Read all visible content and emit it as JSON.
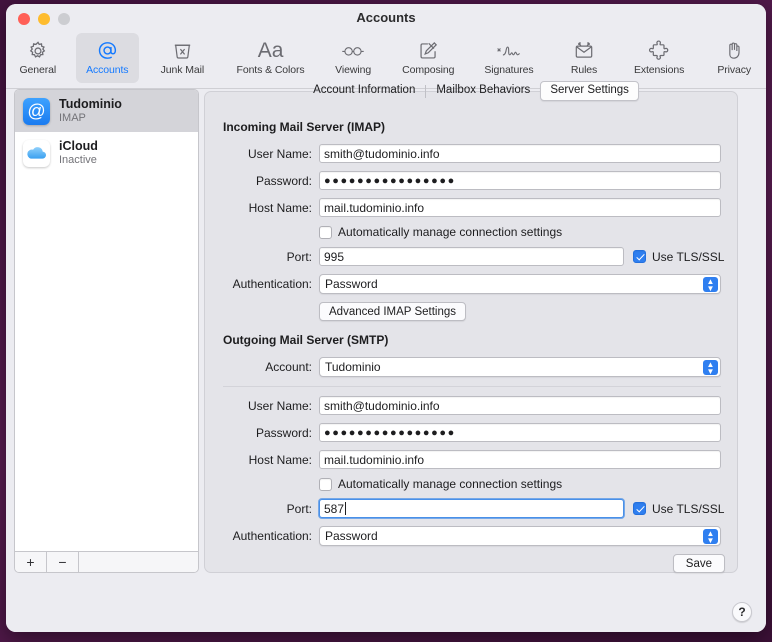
{
  "window": {
    "title": "Accounts",
    "traffic_lights": [
      "close-red",
      "minimize-yellow",
      "zoom-gray-disabled"
    ]
  },
  "toolbar": {
    "items": [
      {
        "label": "General",
        "icon": "gear-icon",
        "selected": false
      },
      {
        "label": "Accounts",
        "icon": "at-sign-icon",
        "selected": true
      },
      {
        "label": "Junk Mail",
        "icon": "trash-x-icon",
        "selected": false
      },
      {
        "label": "Fonts & Colors",
        "icon": "aa-text-icon",
        "selected": false
      },
      {
        "label": "Viewing",
        "icon": "glasses-icon",
        "selected": false
      },
      {
        "label": "Composing",
        "icon": "compose-pencil-icon",
        "selected": false
      },
      {
        "label": "Signatures",
        "icon": "signature-icon",
        "selected": false
      },
      {
        "label": "Rules",
        "icon": "envelope-arrows-icon",
        "selected": false
      },
      {
        "label": "Extensions",
        "icon": "puzzle-piece-icon",
        "selected": false
      },
      {
        "label": "Privacy",
        "icon": "hand-icon",
        "selected": false
      }
    ]
  },
  "sidebar": {
    "accounts": [
      {
        "name": "Tudominio",
        "status": "IMAP",
        "icon": "mail-at-icon",
        "selected": true
      },
      {
        "name": "iCloud",
        "status": "Inactive",
        "icon": "icloud-icon",
        "selected": false
      }
    ],
    "add_label": "+",
    "remove_label": "−"
  },
  "tabs": [
    {
      "label": "Account Information",
      "active": false
    },
    {
      "label": "Mailbox Behaviors",
      "active": false
    },
    {
      "label": "Server Settings",
      "active": true
    }
  ],
  "incoming": {
    "title": "Incoming Mail Server (IMAP)",
    "user_name_label": "User Name:",
    "user_name_value": "smith@tudominio.info",
    "password_label": "Password:",
    "password_value": "●●●●●●●●●●●●●●●●",
    "host_name_label": "Host Name:",
    "host_name_value": "mail.tudominio.info",
    "auto_manage_label": "Automatically manage connection settings",
    "auto_manage_checked": false,
    "port_label": "Port:",
    "port_value": "995",
    "tls_label": "Use TLS/SSL",
    "tls_checked": true,
    "auth_label": "Authentication:",
    "auth_value": "Password",
    "advanced_button": "Advanced IMAP Settings"
  },
  "outgoing": {
    "title": "Outgoing Mail Server (SMTP)",
    "account_label": "Account:",
    "account_value": "Tudominio",
    "user_name_label": "User Name:",
    "user_name_value": "smith@tudominio.info",
    "password_label": "Password:",
    "password_value": "●●●●●●●●●●●●●●●●",
    "host_name_label": "Host Name:",
    "host_name_value": "mail.tudominio.info",
    "auto_manage_label": "Automatically manage connection settings",
    "auto_manage_checked": false,
    "port_label": "Port:",
    "port_value": "587",
    "port_focused": true,
    "tls_label": "Use TLS/SSL",
    "tls_checked": true,
    "auth_label": "Authentication:",
    "auth_value": "Password"
  },
  "footer": {
    "save_label": "Save",
    "help_label": "?"
  },
  "colors": {
    "accent": "#157aff",
    "checkbox_on": "#2f7ff0",
    "window_bg": "#ececf1",
    "panel_bg": "#e4e4e9",
    "desktop_bg": "#4a1a4a"
  }
}
